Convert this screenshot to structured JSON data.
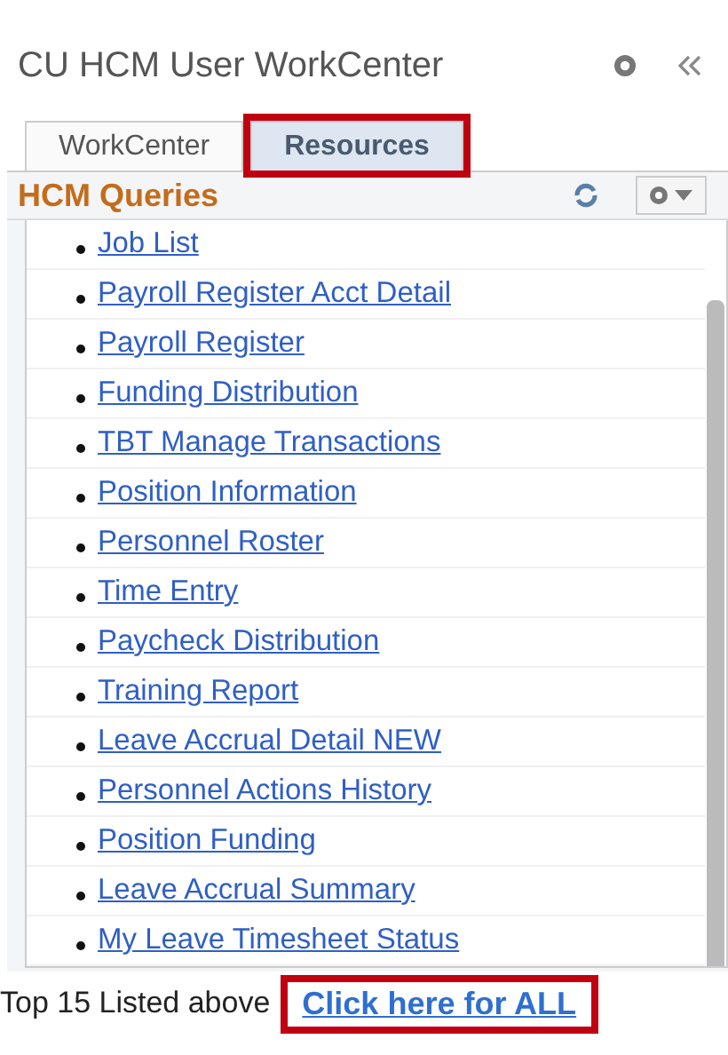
{
  "title": "CU HCM User WorkCenter",
  "tabs": [
    {
      "label": "WorkCenter",
      "selected": false,
      "highlighted": false
    },
    {
      "label": "Resources",
      "selected": true,
      "highlighted": true
    }
  ],
  "pagelet": {
    "title": "HCM Queries",
    "links": [
      "Job List",
      "Payroll Register Acct Detail",
      "Payroll Register",
      "Funding Distribution",
      "TBT Manage Transactions",
      "Position Information",
      "Personnel Roster",
      "Time Entry",
      "Paycheck Distribution",
      "Training Report",
      "Leave Accrual Detail NEW",
      "Personnel Actions History",
      "Position Funding",
      "Leave Accrual Summary",
      "My Leave Timesheet Status"
    ]
  },
  "footer": {
    "text": "Top 15 Listed above",
    "link": "Click here for ALL",
    "link_highlighted": true
  }
}
